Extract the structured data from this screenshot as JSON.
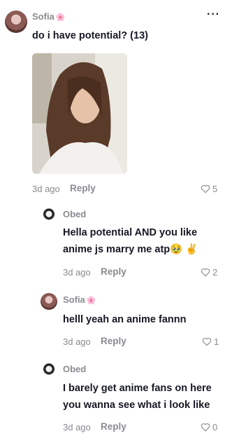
{
  "comments": [
    {
      "user": "Sofia",
      "user_badge": "🌸",
      "text_lines": [
        "do i have potential? (13)"
      ],
      "time": "3d ago",
      "reply_label": "Reply",
      "likes": "5",
      "has_photo": true
    }
  ],
  "replies": [
    {
      "user": "Obed",
      "text_lines": [
        "Hella potential AND you like",
        "anime js marry me atp🥹 ✌️"
      ],
      "time": "3d ago",
      "reply_label": "Reply",
      "likes": "2"
    },
    {
      "user": "Sofia",
      "user_badge": "🌸",
      "text_lines": [
        "helll yeah an anime fannn"
      ],
      "time": "3d ago",
      "reply_label": "Reply",
      "likes": "1"
    },
    {
      "user": "Obed",
      "text_lines": [
        "I barely get anime fans on here",
        "you wanna see what i look like"
      ],
      "time": "3d ago",
      "reply_label": "Reply",
      "likes": "0"
    }
  ],
  "more_options": "···",
  "icons": {
    "like": "heart-outline-icon",
    "options": "more-options-icon"
  },
  "colors": {
    "muted": "#8a8b91",
    "text": "#161823",
    "badge": "#f08fb2"
  }
}
